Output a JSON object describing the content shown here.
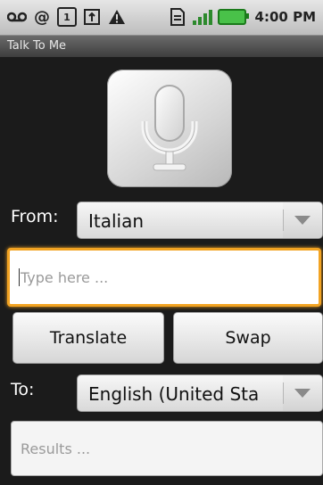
{
  "status_bar": {
    "time": "4:00 PM",
    "left_icons": [
      "voicemail-icon",
      "at-icon",
      "calendar-icon",
      "usb-icon",
      "warning-icon"
    ],
    "calendar_day": "1",
    "right_icons": [
      "sd-card-icon",
      "signal-icon",
      "battery-icon"
    ]
  },
  "app": {
    "title": "Talk To Me"
  },
  "from": {
    "label": "From:",
    "selected": "Italian"
  },
  "source_input": {
    "placeholder": "Type here ..."
  },
  "buttons": {
    "translate": "Translate",
    "swap": "Swap"
  },
  "to": {
    "label": "To:",
    "selected": "English (United Sta"
  },
  "results": {
    "placeholder": "Results ..."
  },
  "colors": {
    "focus": "#f2a322",
    "background": "#1b1b1b"
  }
}
